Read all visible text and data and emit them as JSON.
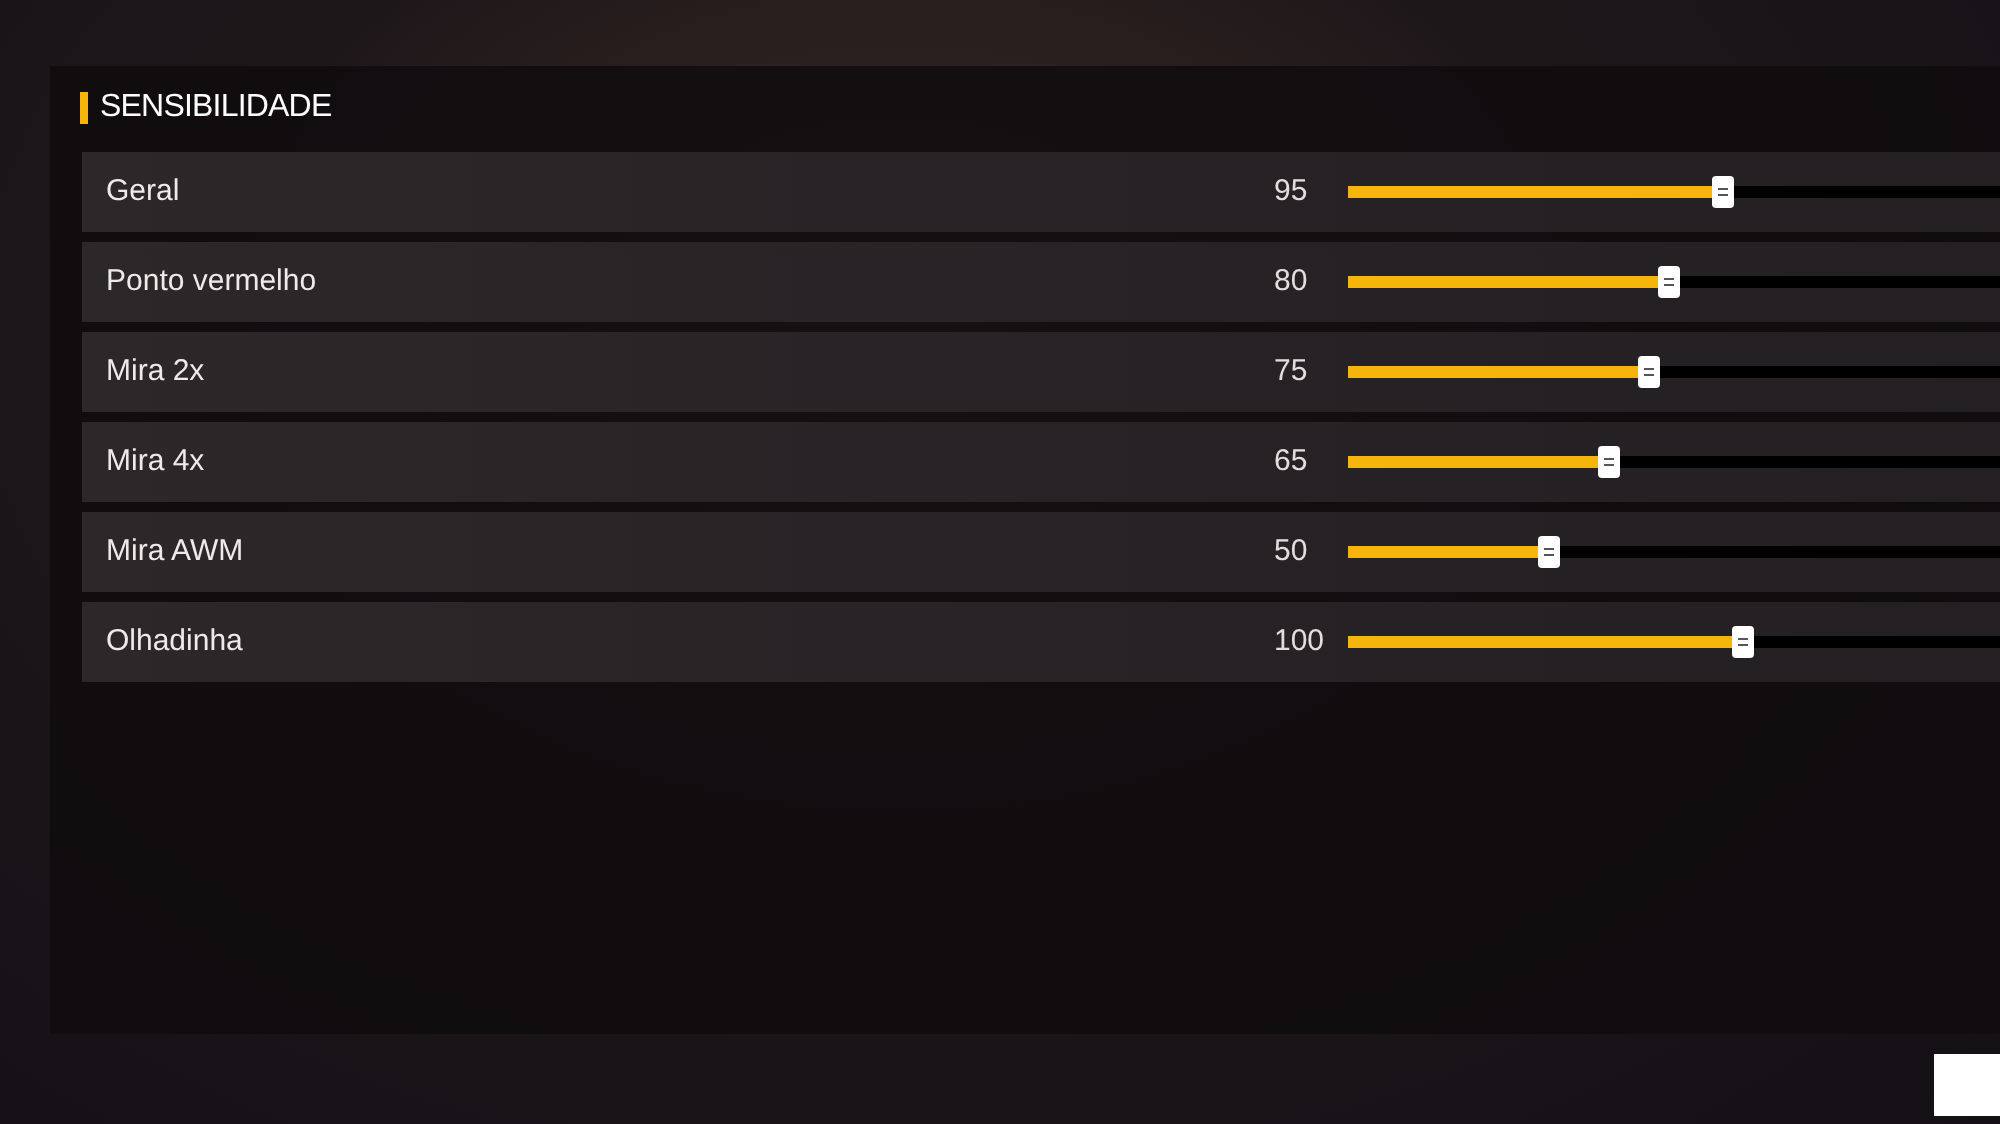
{
  "section": {
    "title": "SENSIBILIDADE"
  },
  "settings": [
    {
      "label": "Geral",
      "reading": "95",
      "level": 0.574
    },
    {
      "label": "Ponto vermelho",
      "reading": "80",
      "level": 0.491
    },
    {
      "label": "Mira 2x",
      "reading": "75",
      "level": 0.46
    },
    {
      "label": "Mira 4x",
      "reading": "65",
      "level": 0.399
    },
    {
      "label": "Mira AWM",
      "reading": "50",
      "level": 0.307
    },
    {
      "label": "Olhadinha",
      "reading": "100",
      "level": 0.604
    }
  ]
}
